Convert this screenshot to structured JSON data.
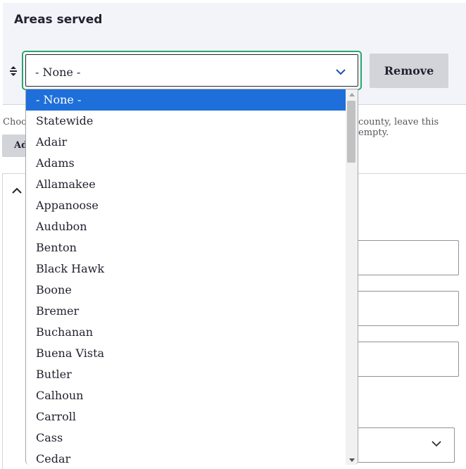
{
  "section": {
    "title": "Areas served"
  },
  "row": {
    "select_value": "- None -",
    "remove_label": "Remove"
  },
  "help": {
    "left_fragment": "Choos",
    "right_fragment": "county, leave this empty."
  },
  "add_button": {
    "label_fragment": "Ad"
  },
  "dropdown": {
    "options": [
      "- None -",
      "Statewide",
      "Adair",
      "Adams",
      "Allamakee",
      "Appanoose",
      "Audubon",
      "Benton",
      "Black Hawk",
      "Boone",
      "Bremer",
      "Buchanan",
      "Buena Vista",
      "Butler",
      "Calhoun",
      "Carroll",
      "Cass",
      "Cedar"
    ],
    "selected_index": 0
  },
  "colors": {
    "focus_ring": "#26a769",
    "selected_option": "#1e6fd9",
    "chevron": "#1e4fb4",
    "panel_bg": "#f3f4f9",
    "button_bg": "#d3d4d9"
  },
  "icons": {
    "drag": "drag-handle-icon",
    "select_chevron": "chevron-down-icon",
    "collapse": "chevron-up-icon"
  }
}
